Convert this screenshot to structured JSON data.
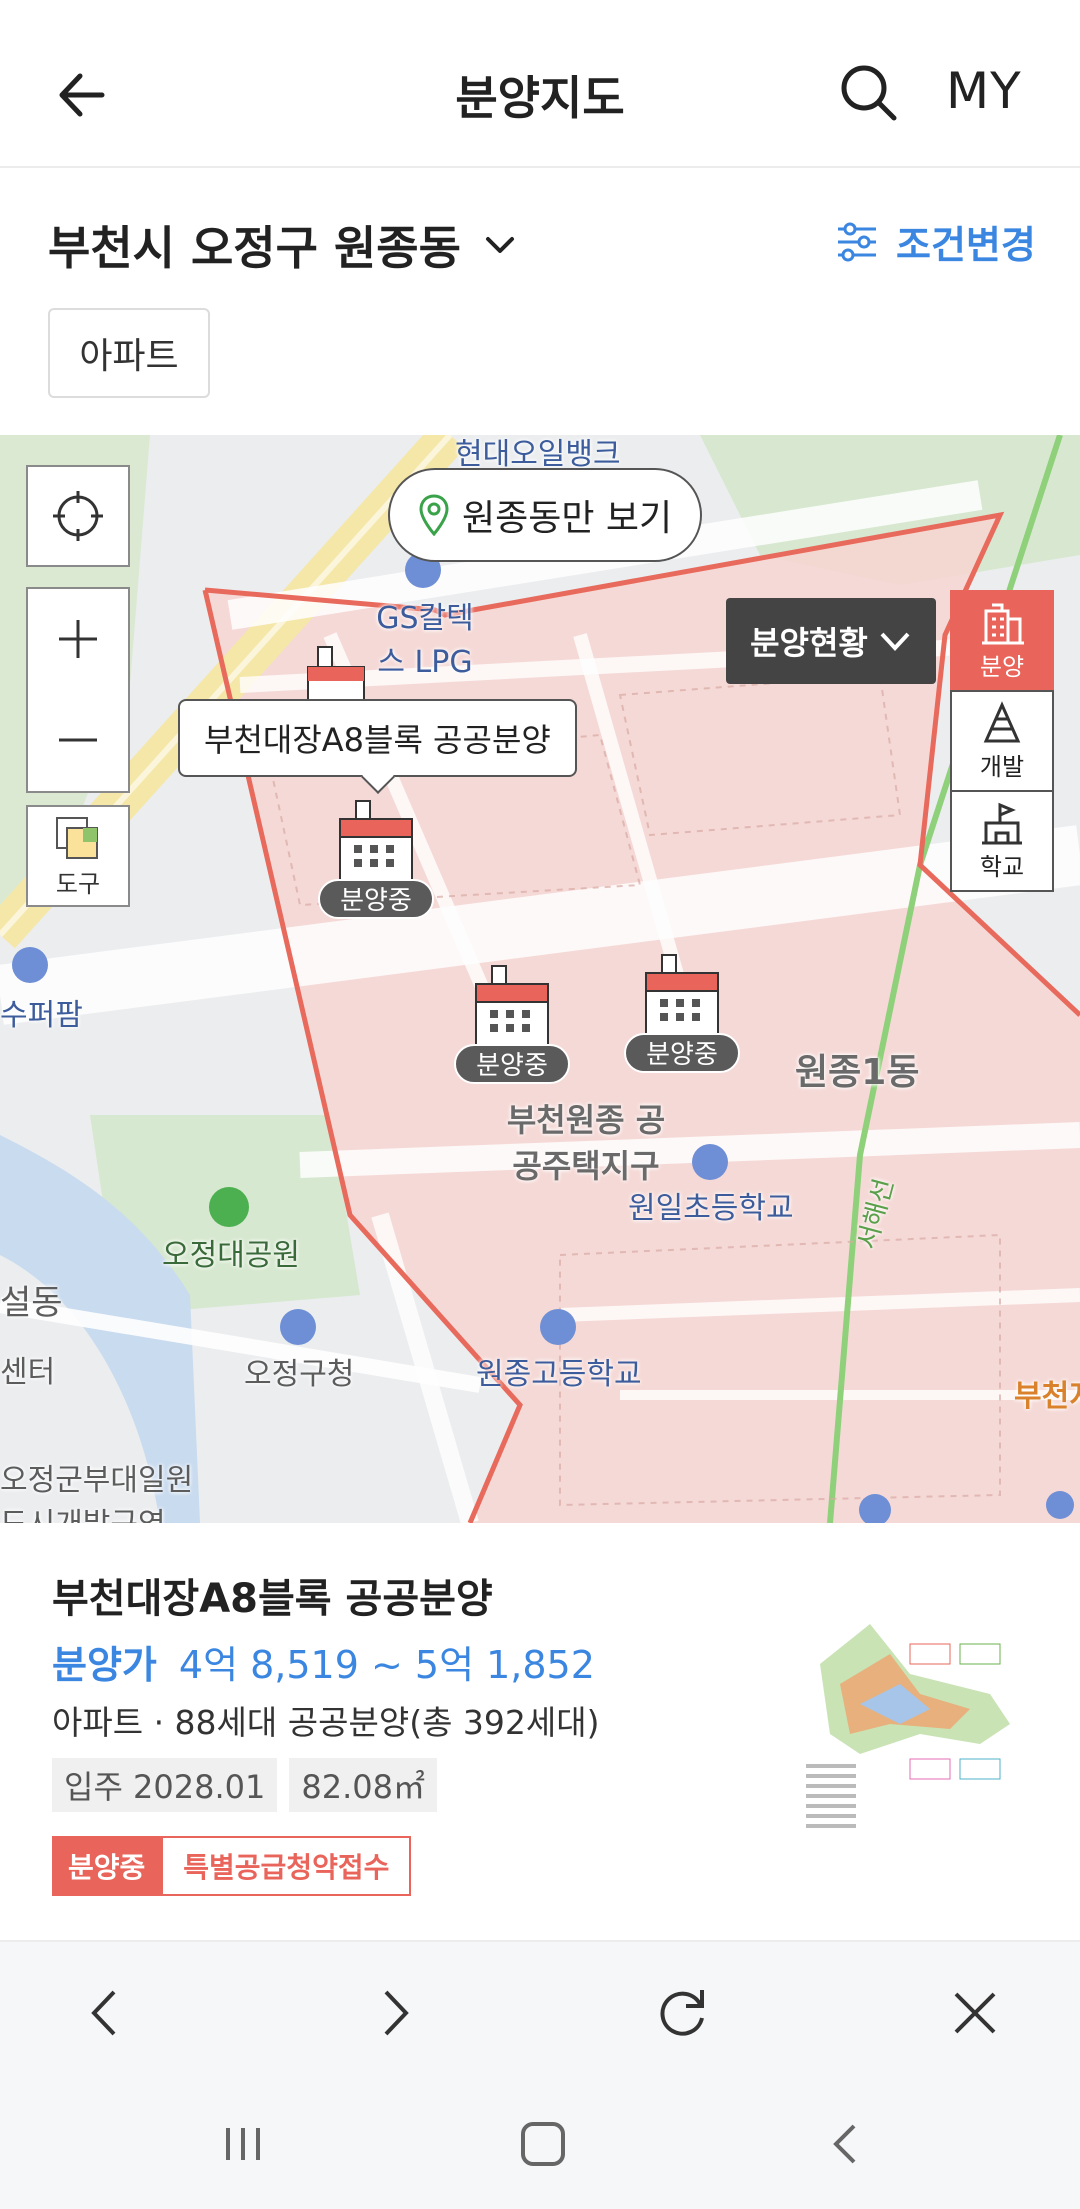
{
  "header": {
    "title": "분양지도",
    "my_label": "MY"
  },
  "location": {
    "label": "부천시 오정구 원종동",
    "filter_label": "조건변경",
    "chip_label": "아파트"
  },
  "map": {
    "region_button_label": "원종동만 보기",
    "tool_label": "도구",
    "status_dropdown_label": "분양현황",
    "layers": [
      {
        "label": "분양"
      },
      {
        "label": "개발"
      },
      {
        "label": "학교"
      }
    ],
    "tooltip": "부천대장A8블록 공공분양",
    "marker_badge": "분양중",
    "labels": {
      "hyundai_bank": "현대오일뱅크",
      "gs_lpg": "GS칼텍스 LPG",
      "super": "수퍼팜",
      "wonjong1": "원종1동",
      "bucheon_wonjong": "부천원종 공공주택지구",
      "wonil_school": "원일초등학교",
      "ojeong_park": "오정대공원",
      "ojeong_office": "오정구청",
      "wonjong_high": "원종고등학교",
      "ojeong_army": "오정군부대일원 도시개발구역",
      "seohae_line": "서해선",
      "dong_fragment": "설동",
      "center_fragment": "센터",
      "bucheon_fragment": "부천지"
    }
  },
  "listing": {
    "title": "부천대장A8블록 공공분양",
    "price_label": "분양가",
    "price_value": "4억 8,519 ~ 5억 1,852",
    "description": "아파트 · 88세대 공공분양(총 392세대)",
    "move_in": "입주 2028.01",
    "area": "82.08㎡",
    "status": "분양중",
    "status_detail": "특별공급청약접수"
  },
  "colors": {
    "accent_blue": "#3a86e0",
    "accent_red": "#e9645a"
  }
}
